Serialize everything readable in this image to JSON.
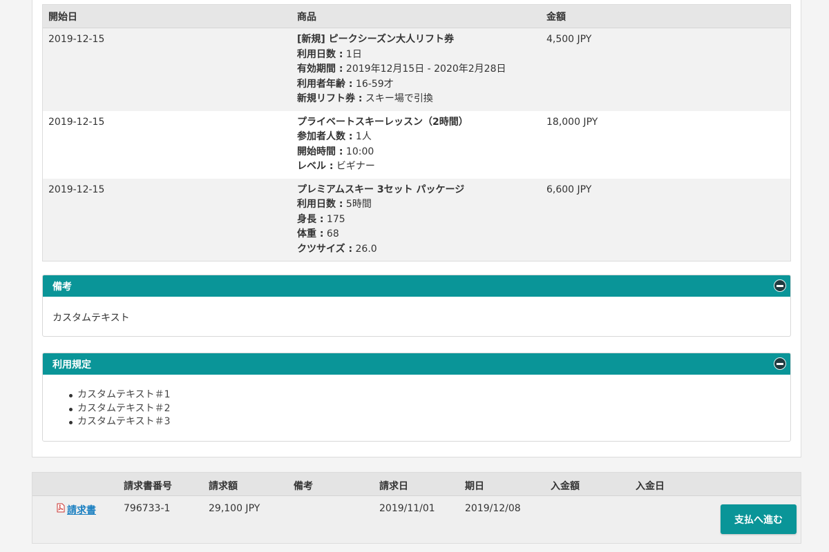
{
  "order_table": {
    "headers": {
      "date": "開始日",
      "item": "商品",
      "amount": "金額"
    },
    "rows": [
      {
        "date": "2019-12-15",
        "title": "[新規] ピークシーズン大人リフト券",
        "details": [
          {
            "label": "利用日数 :",
            "value": " 1日"
          },
          {
            "label": "有効期間 :",
            "value": " 2019年12月15日 - 2020年2月28日"
          },
          {
            "label": "利用者年齢 :",
            "value": " 16-59才"
          },
          {
            "label": "新規リフト券 :",
            "value": " スキー場で引換"
          }
        ],
        "amount": "4,500 JPY"
      },
      {
        "date": "2019-12-15",
        "title": "プライベートスキーレッスン（2時間）",
        "details": [
          {
            "label": "参加者人数 :",
            "value": " 1人"
          },
          {
            "label": "開始時間 :",
            "value": " 10:00"
          },
          {
            "label": "レベル :",
            "value": " ビギナー"
          }
        ],
        "amount": "18,000 JPY"
      },
      {
        "date": "2019-12-15",
        "title": "プレミアムスキー 3セット パッケージ",
        "details": [
          {
            "label": "利用日数 :",
            "value": " 5時間"
          },
          {
            "label": "身長 :",
            "value": " 175"
          },
          {
            "label": "体重 :",
            "value": " 68"
          },
          {
            "label": "クツサイズ :",
            "value": " 26.0"
          }
        ],
        "amount": "6,600 JPY"
      }
    ]
  },
  "remarks_panel": {
    "title": "備考",
    "text": "カスタムテキスト"
  },
  "terms_panel": {
    "title": "利用規定",
    "items": [
      "カスタムテキスト＃1",
      "カスタムテキスト＃2",
      "カスタムテキスト＃3"
    ]
  },
  "invoice": {
    "headers": {
      "number": "請求書番号",
      "amount": "請求額",
      "note": "備考",
      "issue_date": "請求日",
      "due_date": "期日",
      "paid_amount": "入金額",
      "paid_date": "入金日"
    },
    "row": {
      "link": "請求書",
      "number": "796733-1",
      "amount": "29,100 JPY",
      "note": "",
      "issue_date": "2019/11/01",
      "due_date": "2019/12/08",
      "paid_amount": "",
      "paid_date": ""
    },
    "pay_button": "支払へ進む"
  },
  "colors": {
    "accent": "#0a9598",
    "link": "#1a7fc1"
  },
  "icons": {
    "collapse": "minus-circle-icon",
    "pdf": "pdf-icon"
  }
}
